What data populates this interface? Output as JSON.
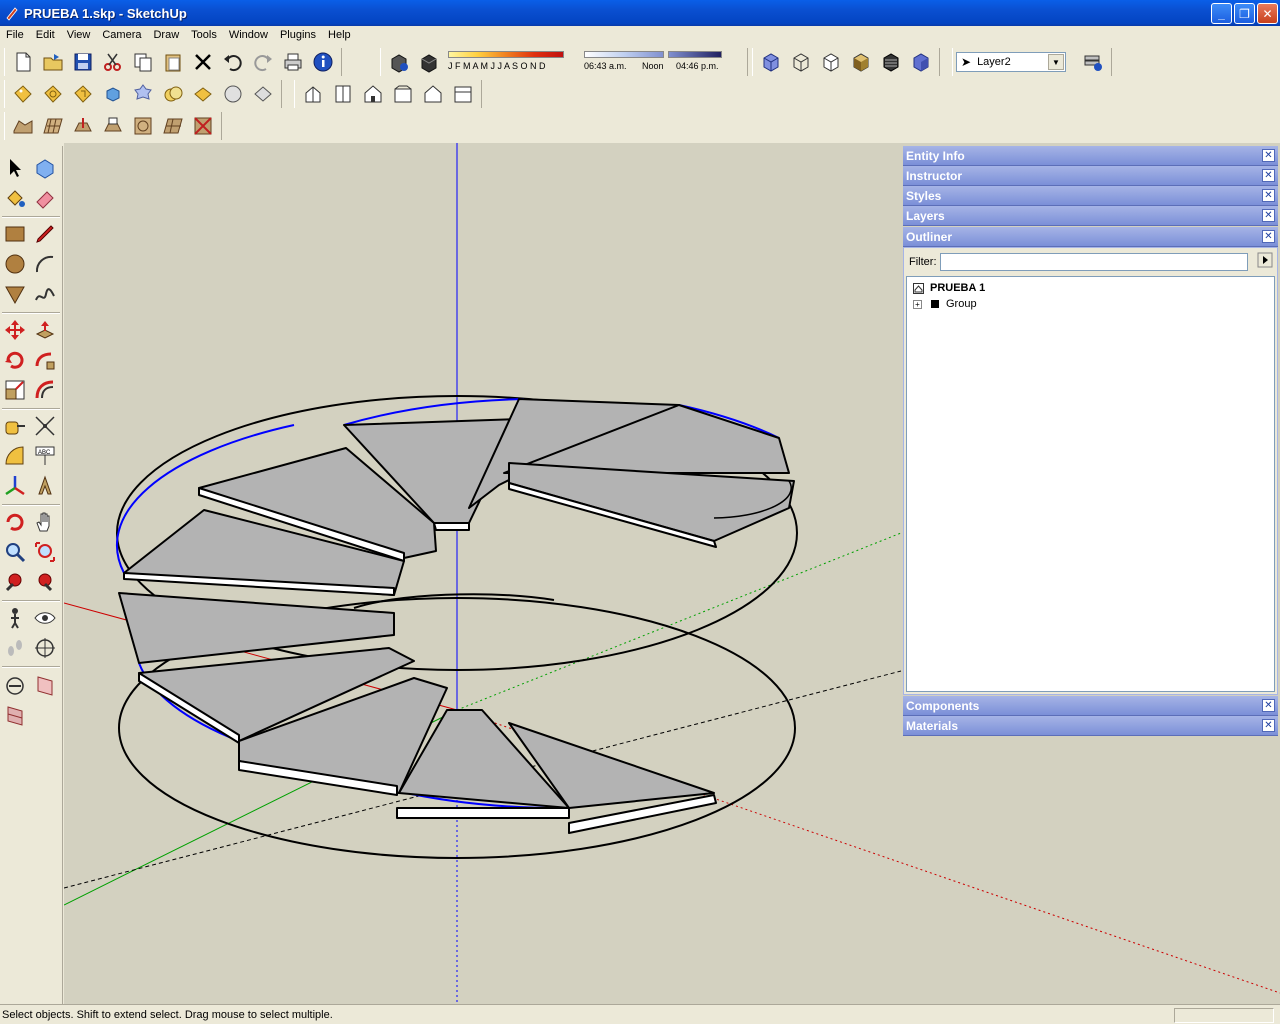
{
  "window": {
    "title": "PRUEBA 1.skp - SketchUp",
    "minimize_label": "_",
    "maximize_label": "❐",
    "close_label": "✕"
  },
  "menu": [
    "File",
    "Edit",
    "View",
    "Camera",
    "Draw",
    "Tools",
    "Window",
    "Plugins",
    "Help"
  ],
  "shadows": {
    "months": "J F M A M J J A S O N D",
    "time_start": "06:43 a.m.",
    "time_noon": "Noon",
    "time_end": "04:46 p.m."
  },
  "layer": {
    "current": "Layer2"
  },
  "tray": {
    "panels": {
      "entity_info": "Entity Info",
      "instructor": "Instructor",
      "styles": "Styles",
      "layers": "Layers",
      "outliner": "Outliner",
      "components": "Components",
      "materials": "Materials"
    },
    "outliner": {
      "filter_label": "Filter:",
      "filter_value": "",
      "root": "PRUEBA 1",
      "child": "Group",
      "expand_symbol": "+"
    }
  },
  "status": {
    "message": "Select objects. Shift to extend select. Drag mouse to select multiple."
  },
  "colors": {
    "viewport_bg": "#d3d1c0",
    "step_fill": "#b3b3b3",
    "axis_blue": "#0000ff",
    "axis_red": "#cc0000",
    "axis_green": "#00a000",
    "panel_header": "#7b8fd8"
  }
}
